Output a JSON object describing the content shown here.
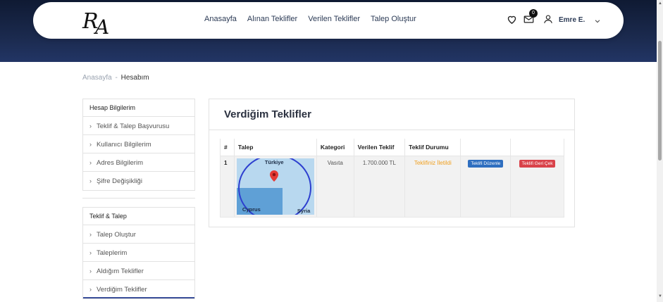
{
  "navbar": {
    "logo_text": "RA",
    "links": [
      "Anasayfa",
      "Alınan Teklifler",
      "Verilen Teklifler",
      "Talep Oluştur"
    ],
    "message_count": "0",
    "user_name": "Emre E."
  },
  "breadcrumb": {
    "home": "Anasayfa",
    "separator": "-",
    "current": "Hesabım"
  },
  "sidebar": {
    "account": {
      "heading": "Hesap Bilgilerim",
      "items": [
        "Teklif & Talep Başvurusu",
        "Kullanıcı Bilgilerim",
        "Adres Bilgilerim",
        "Şifre Değişikliği"
      ]
    },
    "offers": {
      "heading": "Teklif & Talep",
      "items": [
        "Talep Oluştur",
        "Taleplerim",
        "Aldığım Teklifler",
        "Verdiğim Teklifler"
      ]
    }
  },
  "main": {
    "title": "Verdiğim Teklifler",
    "columns": [
      "#",
      "Talep",
      "Kategori",
      "Verilen Teklif",
      "Teklif Durumu",
      "",
      ""
    ],
    "rows": [
      {
        "index": "1",
        "map_labels": {
          "north": "Türkiye",
          "island": "Cyprus",
          "east": "Syria"
        },
        "category": "Vasıta",
        "offer_amount": "1.700.000 TL",
        "status": "Teklifiniz İletildi",
        "edit_button": "Teklifi Düzenle",
        "withdraw_button": "Teklifi Geri Çek"
      }
    ]
  },
  "colors": {
    "header_bg": "#1b2a4e",
    "status": "#f0a020",
    "edit": "#2f6fc0",
    "withdraw": "#d9424a",
    "active_tab": "#3a4f9a"
  }
}
